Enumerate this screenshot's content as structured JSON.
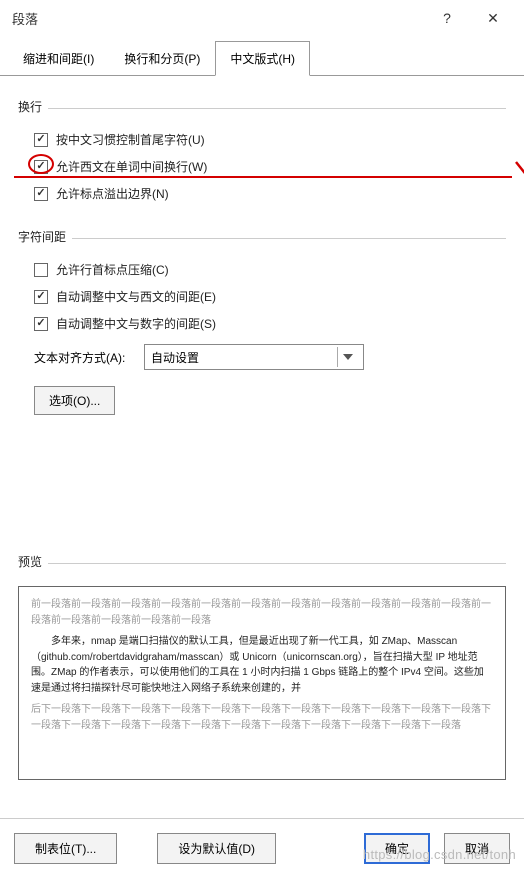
{
  "window": {
    "title": "段落",
    "help": "?",
    "close": "✕"
  },
  "tabs": {
    "indent": "缩进和间距(I)",
    "pagination": "换行和分页(P)",
    "asian": "中文版式(H)"
  },
  "linebreak": {
    "title": "换行",
    "opt1": "按中文习惯控制首尾字符(U)",
    "opt2": "允许西文在单词中间换行(W)",
    "opt3": "允许标点溢出边界(N)"
  },
  "spacing": {
    "title": "字符间距",
    "opt1": "允许行首标点压缩(C)",
    "opt2": "自动调整中文与西文的间距(E)",
    "opt3": "自动调整中文与数字的间距(S)",
    "alignLabel": "文本对齐方式(A):",
    "alignValue": "自动设置",
    "optionsBtn": "选项(O)..."
  },
  "preview": {
    "title": "预览",
    "grayBefore": "前一段落前一段落前一段落前一段落前一段落前一段落前一段落前一段落前一段落前一段落前一段落前一段落前一段落前一段落前一段落前一段落",
    "mid": "　　多年来，nmap 是端口扫描仪的默认工具，但是最近出现了新一代工具，如 ZMap、Masscan（github.com/robertdavidgraham/masscan）或 Unicorn（unicornscan.org），旨在扫描大型 IP 地址范围。ZMap 的作者表示，可以使用他们的工具在 1 小时内扫描 1 Gbps 链路上的整个 IPv4 空间。这些加速是通过将扫描探针尽可能快地注入网络子系统来创建的，并",
    "grayAfter": "后下一段落下一段落下一段落下一段落下一段落下一段落下一段落下一段落下一段落下一段落下一段落下一段落下一段落下一段落下一段落下一段落下一段落下一段落下一段落下一段落下一段落下一段落"
  },
  "footer": {
    "tabs": "制表位(T)...",
    "default": "设为默认值(D)",
    "ok": "确定",
    "cancel": "取消"
  },
  "watermark": "https://blog.csdn.net/tonh"
}
